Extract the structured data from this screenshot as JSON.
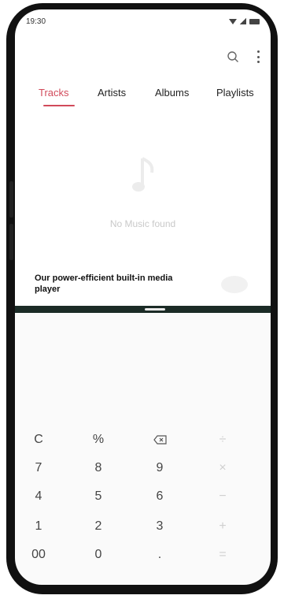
{
  "status_bar": {
    "time": "19:30"
  },
  "toolbar": {
    "search_icon": "search-icon",
    "more_icon": "more-vertical-icon"
  },
  "tabs": [
    {
      "label": "Tracks",
      "active": true
    },
    {
      "label": "Artists"
    },
    {
      "label": "Albums"
    },
    {
      "label": "Playlists"
    }
  ],
  "empty_state": {
    "icon": "music-note-icon",
    "text": "No Music found"
  },
  "promo": {
    "text": "Our power-efficient built-in media player"
  },
  "calculator": {
    "rows": [
      [
        "C",
        "%",
        "backspace",
        "÷"
      ],
      [
        "7",
        "8",
        "9",
        "×"
      ],
      [
        "4",
        "5",
        "6",
        "−"
      ],
      [
        "1",
        "2",
        "3",
        "+"
      ],
      [
        "00",
        "0",
        ".",
        "="
      ]
    ]
  },
  "colors": {
    "accent": "#d14a5a",
    "hinge": "#1b2b26",
    "frame": "#111111"
  }
}
